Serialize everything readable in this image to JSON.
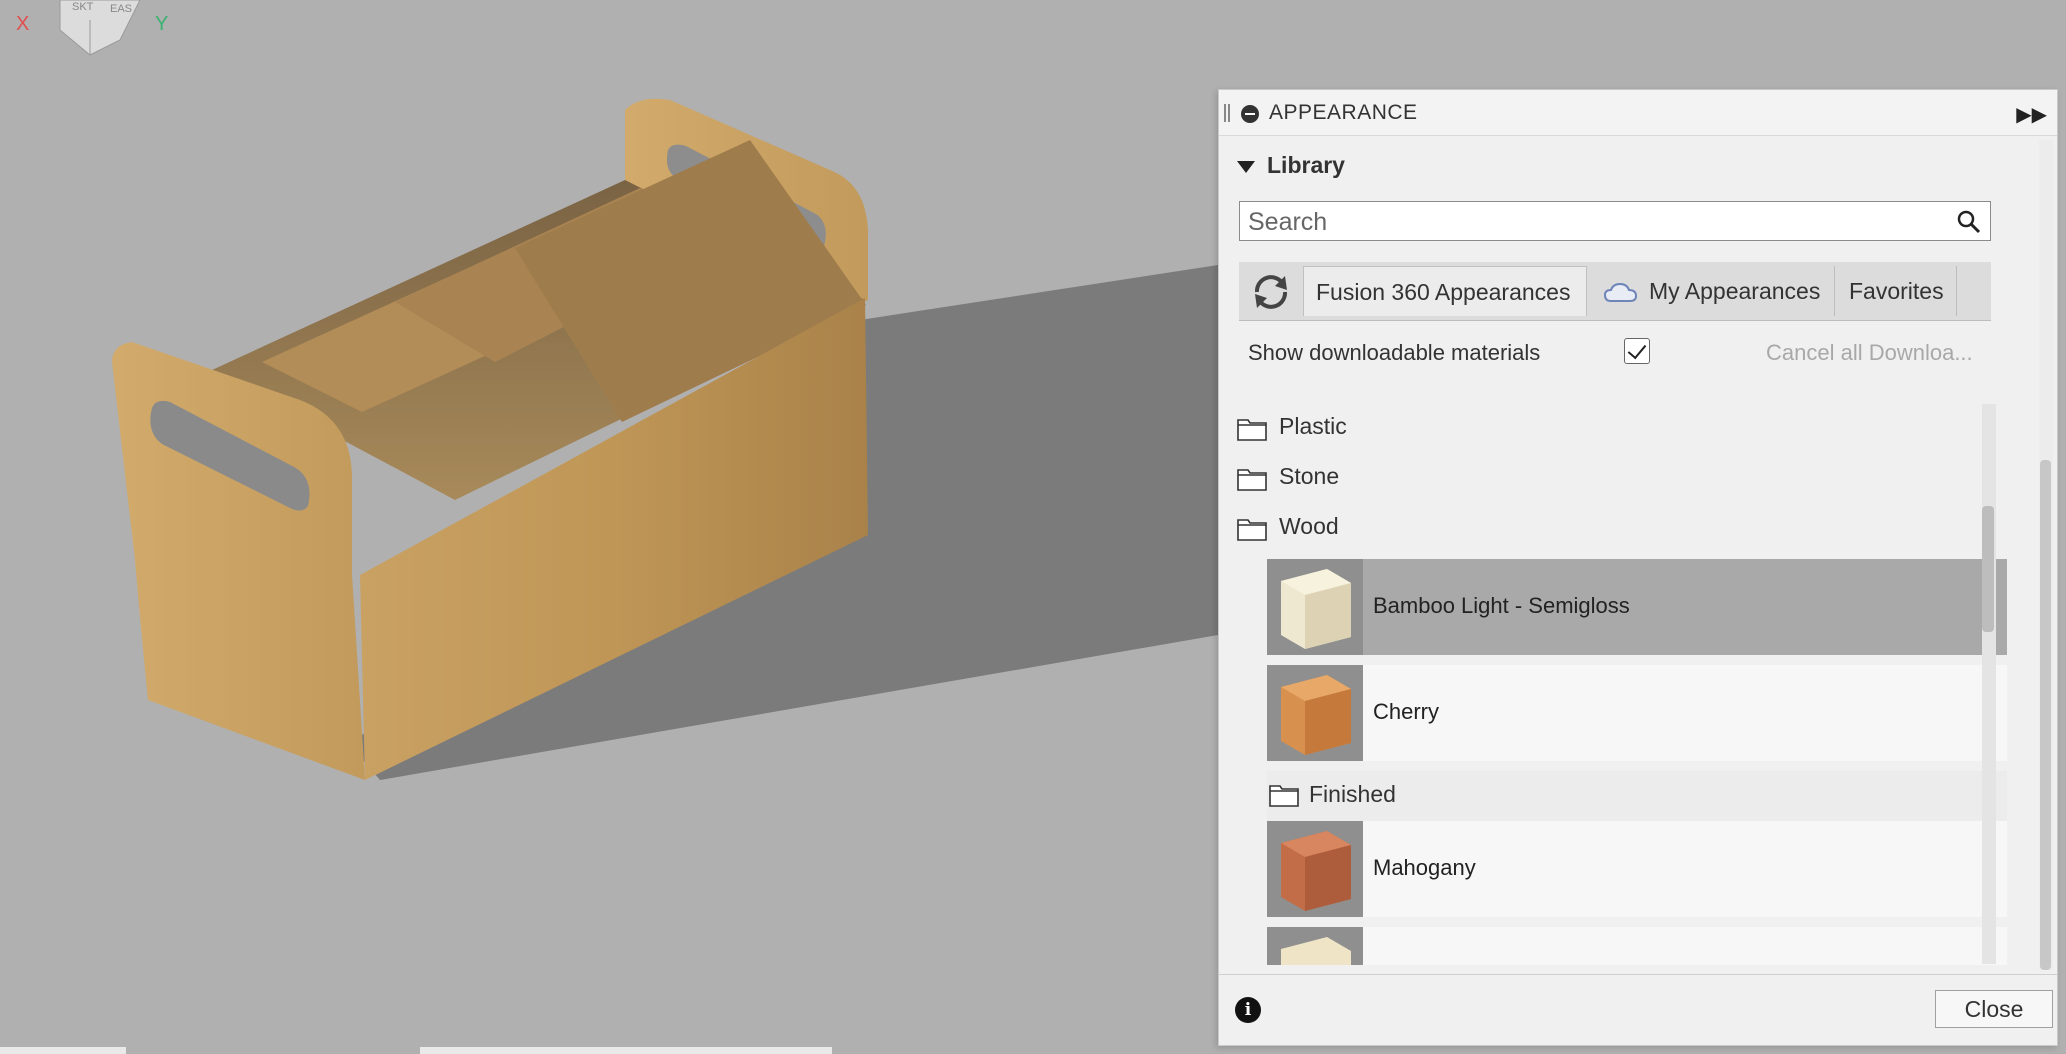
{
  "panel": {
    "title": "APPEARANCE",
    "library_label": "Library",
    "search": {
      "placeholder": "Search",
      "value": ""
    },
    "tabs": [
      {
        "label": "Fusion 360 Appearances",
        "active": true
      },
      {
        "label": "My Appearances",
        "icon": "cloud-icon"
      },
      {
        "label": "Favorites"
      }
    ],
    "show_downloadable_label": "Show downloadable materials",
    "show_downloadable_checked": true,
    "cancel_downloads_label": "Cancel all Downloa...",
    "folders": [
      {
        "label": "Plastic",
        "icon": "folder-icon"
      },
      {
        "label": "Stone",
        "icon": "folder-icon"
      },
      {
        "label": "Wood",
        "icon": "folder-icon"
      }
    ],
    "materials": [
      {
        "label": "Bamboo Light - Semigloss",
        "selected": true,
        "color": "#e9e2ca"
      },
      {
        "label": "Cherry",
        "selected": false,
        "color": "#d4884a"
      },
      {
        "label": "Mahogany",
        "selected": false,
        "color": "#c06c46"
      }
    ],
    "subfolder": {
      "label": "Finished",
      "icon": "folder-icon"
    },
    "close_label": "Close"
  },
  "viewcube": {
    "axis_x": "X",
    "axis_y": "Y",
    "face_top": "SKT",
    "face_right": "EAS"
  },
  "colors": {
    "viewport_bg": "#b0b0b0",
    "wood": "#c49a5a",
    "selection": "#a9a9a9"
  }
}
